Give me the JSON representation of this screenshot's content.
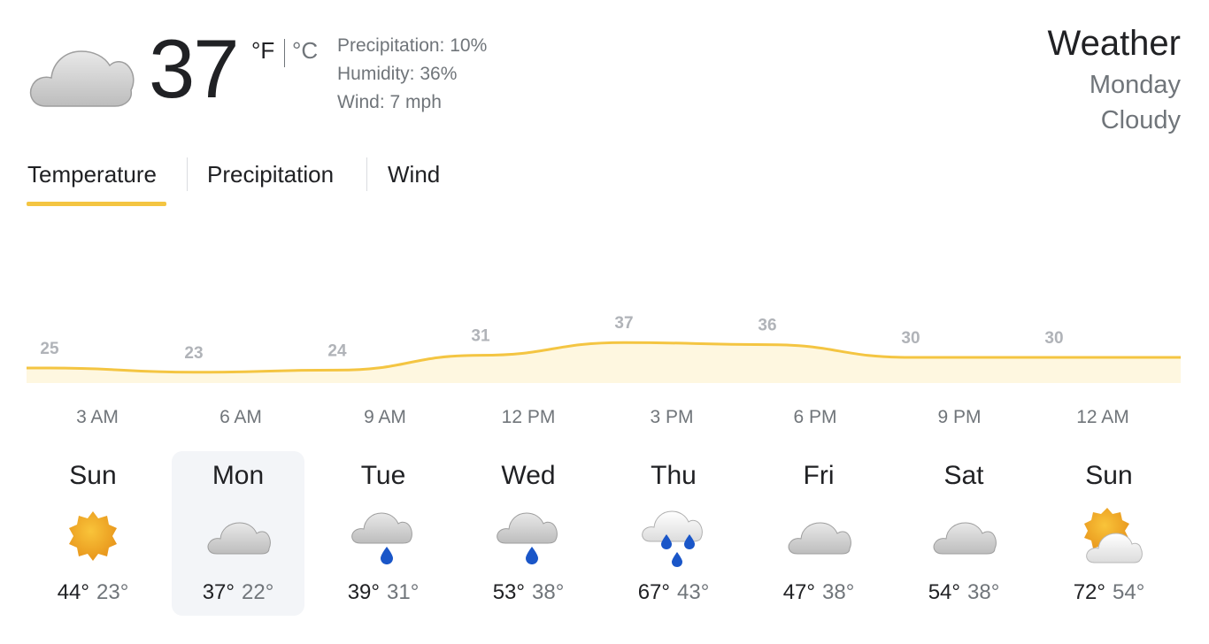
{
  "current": {
    "temperature": "37",
    "unit_f": "°F",
    "unit_c": "°C",
    "icon": "cloudy-icon",
    "precipitation": "Precipitation: 10%",
    "humidity": "Humidity: 36%",
    "wind": "Wind: 7 mph"
  },
  "header": {
    "title": "Weather",
    "day": "Monday",
    "condition": "Cloudy"
  },
  "tabs": [
    {
      "label": "Temperature",
      "selected": true
    },
    {
      "label": "Precipitation",
      "selected": false
    },
    {
      "label": "Wind",
      "selected": false
    }
  ],
  "chart_data": {
    "type": "area",
    "x": [
      "3 AM",
      "6 AM",
      "9 AM",
      "12 PM",
      "3 PM",
      "6 PM",
      "9 PM",
      "12 AM"
    ],
    "values": [
      25,
      23,
      24,
      31,
      37,
      36,
      30,
      30
    ],
    "title": "",
    "xlabel": "",
    "ylabel": "",
    "line_color": "#f4c542",
    "fill_color": "#fef7e0"
  },
  "days": [
    {
      "name": "Sun",
      "icon": "sunny-icon",
      "high": "44°",
      "low": "23°",
      "selected": false
    },
    {
      "name": "Mon",
      "icon": "cloudy-icon",
      "high": "37°",
      "low": "22°",
      "selected": true
    },
    {
      "name": "Tue",
      "icon": "rain-icon",
      "high": "39°",
      "low": "31°",
      "selected": false
    },
    {
      "name": "Wed",
      "icon": "rain-icon",
      "high": "53°",
      "low": "38°",
      "selected": false
    },
    {
      "name": "Thu",
      "icon": "heavy-rain-icon",
      "high": "67°",
      "low": "43°",
      "selected": false
    },
    {
      "name": "Fri",
      "icon": "cloudy-icon",
      "high": "47°",
      "low": "38°",
      "selected": false
    },
    {
      "name": "Sat",
      "icon": "cloudy-icon",
      "high": "54°",
      "low": "38°",
      "selected": false
    },
    {
      "name": "Sun",
      "icon": "partly-cloudy-icon",
      "high": "72°",
      "low": "54°",
      "selected": false
    }
  ]
}
